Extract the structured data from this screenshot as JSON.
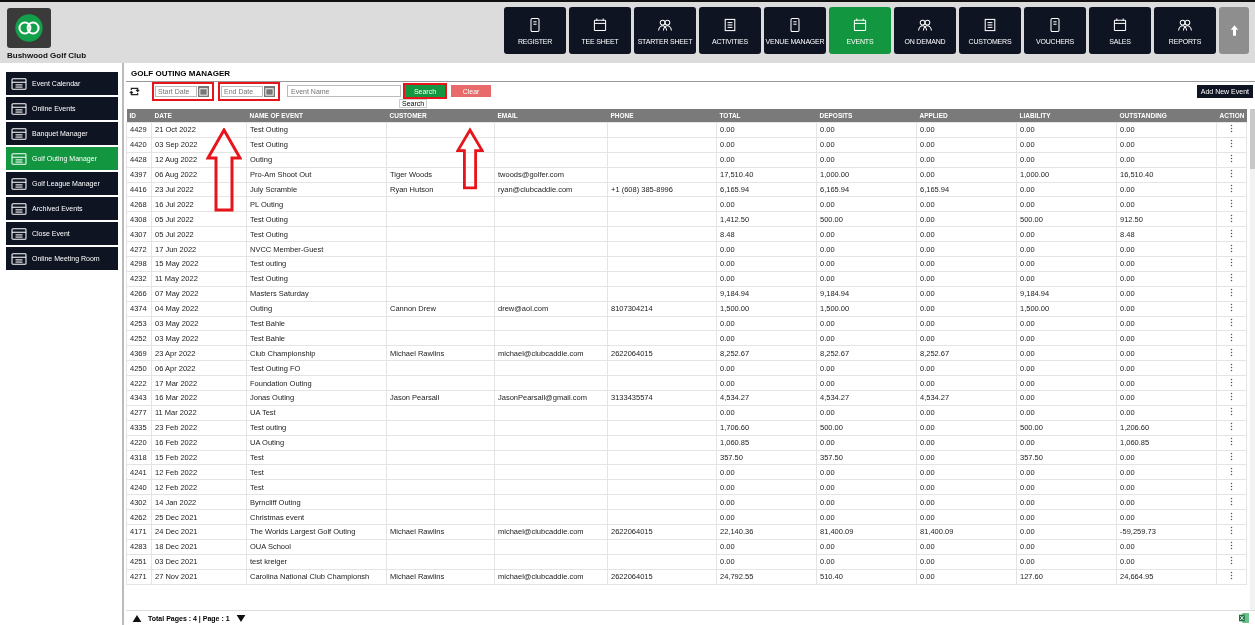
{
  "club": {
    "name": "Bushwood Golf Club"
  },
  "nav": [
    {
      "label": "REGISTER",
      "selected": false
    },
    {
      "label": "TEE SHEET",
      "selected": false
    },
    {
      "label": "STARTER SHEET",
      "selected": false
    },
    {
      "label": "ACTIVITIES",
      "selected": false
    },
    {
      "label": "VENUE MANAGER",
      "selected": false
    },
    {
      "label": "EVENTS",
      "selected": true
    },
    {
      "label": "ON DEMAND",
      "selected": false
    },
    {
      "label": "CUSTOMERS",
      "selected": false
    },
    {
      "label": "VOUCHERS",
      "selected": false
    },
    {
      "label": "SALES",
      "selected": false
    },
    {
      "label": "REPORTS",
      "selected": false
    }
  ],
  "sidebar": {
    "items": [
      {
        "label": "Event Calendar",
        "selected": false
      },
      {
        "label": "Online Events",
        "selected": false
      },
      {
        "label": "Banquet Manager",
        "selected": false
      },
      {
        "label": "Golf Outing Manager",
        "selected": true
      },
      {
        "label": "Golf League Manager",
        "selected": false
      },
      {
        "label": "Archived Events",
        "selected": false
      },
      {
        "label": "Close Event",
        "selected": false
      },
      {
        "label": "Online Meeting Room",
        "selected": false
      }
    ]
  },
  "page": {
    "title": "GOLF OUTING MANAGER"
  },
  "toolbar": {
    "start_date": {
      "placeholder": "Start Date",
      "highlighted": true
    },
    "end_date": {
      "placeholder": "End Date",
      "highlighted": true
    },
    "event_name": {
      "placeholder": "Event Name"
    },
    "search": {
      "label": "Search",
      "highlighted": true,
      "tooltip": "Search"
    },
    "clear": {
      "label": "Clear"
    },
    "add": {
      "label": "Add New Event"
    }
  },
  "table": {
    "columns": [
      "ID",
      "DATE",
      "NAME OF EVENT",
      "CUSTOMER",
      "EMAIL",
      "PHONE",
      "TOTAL",
      "DEPOSITS",
      "APPLIED",
      "LIABILITY",
      "OUTSTANDING",
      "ACTION"
    ],
    "rows": [
      {
        "id": "4429",
        "date": "21 Oct 2022",
        "event": "Test Outing",
        "total": "0.00",
        "deposits": "0.00",
        "applied": "0.00",
        "liability": "0.00",
        "outstanding": "0.00"
      },
      {
        "id": "4420",
        "date": "03 Sep 2022",
        "event": "Test Outing",
        "total": "0.00",
        "deposits": "0.00",
        "applied": "0.00",
        "liability": "0.00",
        "outstanding": "0.00"
      },
      {
        "id": "4428",
        "date": "12 Aug 2022",
        "event": "Outing",
        "total": "0.00",
        "deposits": "0.00",
        "applied": "0.00",
        "liability": "0.00",
        "outstanding": "0.00"
      },
      {
        "id": "4397",
        "date": "06 Aug 2022",
        "event": "Pro-Am Shoot Out",
        "customer": "Tiger Woods",
        "email": "twoods@golfer.com",
        "total": "17,510.40",
        "deposits": "1,000.00",
        "applied": "0.00",
        "liability": "1,000.00",
        "outstanding": "16,510.40"
      },
      {
        "id": "4416",
        "date": "23 Jul 2022",
        "event": "July Scramble",
        "customer": "Ryan Hutson",
        "email": "ryan@clubcaddie.com",
        "phone": "+1 (608) 385-8996",
        "total": "6,165.94",
        "deposits": "6,165.94",
        "applied": "6,165.94",
        "liability": "0.00",
        "outstanding": "0.00"
      },
      {
        "id": "4268",
        "date": "16 Jul 2022",
        "event": "PL Outing",
        "total": "0.00",
        "deposits": "0.00",
        "applied": "0.00",
        "liability": "0.00",
        "outstanding": "0.00"
      },
      {
        "id": "4308",
        "date": "05 Jul 2022",
        "event": "Test Outing",
        "total": "1,412.50",
        "deposits": "500.00",
        "applied": "0.00",
        "liability": "500.00",
        "outstanding": "912.50"
      },
      {
        "id": "4307",
        "date": "05 Jul 2022",
        "event": "Test Outing",
        "total": "8.48",
        "deposits": "0.00",
        "applied": "0.00",
        "liability": "0.00",
        "outstanding": "8.48"
      },
      {
        "id": "4272",
        "date": "17 Jun 2022",
        "event": "NVCC Member-Guest",
        "total": "0.00",
        "deposits": "0.00",
        "applied": "0.00",
        "liability": "0.00",
        "outstanding": "0.00"
      },
      {
        "id": "4298",
        "date": "15 May 2022",
        "event": "Test outing",
        "total": "0.00",
        "deposits": "0.00",
        "applied": "0.00",
        "liability": "0.00",
        "outstanding": "0.00"
      },
      {
        "id": "4232",
        "date": "11 May 2022",
        "event": "Test Outing",
        "total": "0.00",
        "deposits": "0.00",
        "applied": "0.00",
        "liability": "0.00",
        "outstanding": "0.00"
      },
      {
        "id": "4266",
        "date": "07 May 2022",
        "event": "Masters Saturday",
        "total": "9,184.94",
        "deposits": "9,184.94",
        "applied": "0.00",
        "liability": "9,184.94",
        "outstanding": "0.00"
      },
      {
        "id": "4374",
        "date": "04 May 2022",
        "event": "Outing",
        "customer": "Cannon Drew",
        "email": "drew@aol.com",
        "phone": "8107304214",
        "total": "1,500.00",
        "deposits": "1,500.00",
        "applied": "0.00",
        "liability": "1,500.00",
        "outstanding": "0.00"
      },
      {
        "id": "4253",
        "date": "03 May 2022",
        "event": "Test Bahle",
        "total": "0.00",
        "deposits": "0.00",
        "applied": "0.00",
        "liability": "0.00",
        "outstanding": "0.00"
      },
      {
        "id": "4252",
        "date": "03 May 2022",
        "event": "Test Bahle",
        "total": "0.00",
        "deposits": "0.00",
        "applied": "0.00",
        "liability": "0.00",
        "outstanding": "0.00"
      },
      {
        "id": "4369",
        "date": "23 Apr 2022",
        "event": "Club Championship",
        "customer": "Michael Rawlins",
        "email": "michael@clubcaddie.com",
        "phone": "2622064015",
        "total": "8,252.67",
        "deposits": "8,252.67",
        "applied": "8,252.67",
        "liability": "0.00",
        "outstanding": "0.00"
      },
      {
        "id": "4250",
        "date": "06 Apr 2022",
        "event": "Test Outing FO",
        "total": "0.00",
        "deposits": "0.00",
        "applied": "0.00",
        "liability": "0.00",
        "outstanding": "0.00"
      },
      {
        "id": "4222",
        "date": "17 Mar 2022",
        "event": "Foundation Outing",
        "total": "0.00",
        "deposits": "0.00",
        "applied": "0.00",
        "liability": "0.00",
        "outstanding": "0.00"
      },
      {
        "id": "4343",
        "date": "16 Mar 2022",
        "event": "Jonas Outing",
        "customer": "Jason Pearsall",
        "email": "JasonPearsall@gmail.com",
        "phone": "3133435574",
        "total": "4,534.27",
        "deposits": "4,534.27",
        "applied": "4,534.27",
        "liability": "0.00",
        "outstanding": "0.00"
      },
      {
        "id": "4277",
        "date": "11 Mar 2022",
        "event": "UA Test",
        "total": "0.00",
        "deposits": "0.00",
        "applied": "0.00",
        "liability": "0.00",
        "outstanding": "0.00"
      },
      {
        "id": "4335",
        "date": "23 Feb 2022",
        "event": "Test outing",
        "total": "1,706.60",
        "deposits": "500.00",
        "applied": "0.00",
        "liability": "500.00",
        "outstanding": "1,206.60"
      },
      {
        "id": "4220",
        "date": "16 Feb 2022",
        "event": "UA Outing",
        "total": "1,060.85",
        "deposits": "0.00",
        "applied": "0.00",
        "liability": "0.00",
        "outstanding": "1,060.85"
      },
      {
        "id": "4318",
        "date": "15 Feb 2022",
        "event": "Test",
        "total": "357.50",
        "deposits": "357.50",
        "applied": "0.00",
        "liability": "357.50",
        "outstanding": "0.00"
      },
      {
        "id": "4241",
        "date": "12 Feb 2022",
        "event": "Test",
        "total": "0.00",
        "deposits": "0.00",
        "applied": "0.00",
        "liability": "0.00",
        "outstanding": "0.00"
      },
      {
        "id": "4240",
        "date": "12 Feb 2022",
        "event": "Test",
        "total": "0.00",
        "deposits": "0.00",
        "applied": "0.00",
        "liability": "0.00",
        "outstanding": "0.00"
      },
      {
        "id": "4302",
        "date": "14 Jan 2022",
        "event": "Byrncliff Outing",
        "total": "0.00",
        "deposits": "0.00",
        "applied": "0.00",
        "liability": "0.00",
        "outstanding": "0.00"
      },
      {
        "id": "4262",
        "date": "25 Dec 2021",
        "event": "Christmas event",
        "total": "0.00",
        "deposits": "0.00",
        "applied": "0.00",
        "liability": "0.00",
        "outstanding": "0.00"
      },
      {
        "id": "4171",
        "date": "24 Dec 2021",
        "event": "The Worlds Largest Golf Outing",
        "customer": "Michael Rawlins",
        "email": "michael@clubcaddie.com",
        "phone": "2622064015",
        "total": "22,140.36",
        "deposits": "81,400.09",
        "applied": "81,400.09",
        "liability": "0.00",
        "outstanding": "-59,259.73"
      },
      {
        "id": "4283",
        "date": "18 Dec 2021",
        "event": "OUA School",
        "total": "0.00",
        "deposits": "0.00",
        "applied": "0.00",
        "liability": "0.00",
        "outstanding": "0.00"
      },
      {
        "id": "4251",
        "date": "03 Dec 2021",
        "event": "test kreiger",
        "total": "0.00",
        "deposits": "0.00",
        "applied": "0.00",
        "liability": "0.00",
        "outstanding": "0.00"
      },
      {
        "id": "4271",
        "date": "27 Nov 2021",
        "event": "Carolina National Club Championsh",
        "customer": "Michael Rawlins",
        "email": "michael@clubcaddie.com",
        "phone": "2622064015",
        "total": "24,792.55",
        "deposits": "510.40",
        "applied": "0.00",
        "liability": "127.60",
        "outstanding": "24,664.95"
      }
    ]
  },
  "pager": {
    "text": "Total Pages : 4 | Page : 1"
  }
}
